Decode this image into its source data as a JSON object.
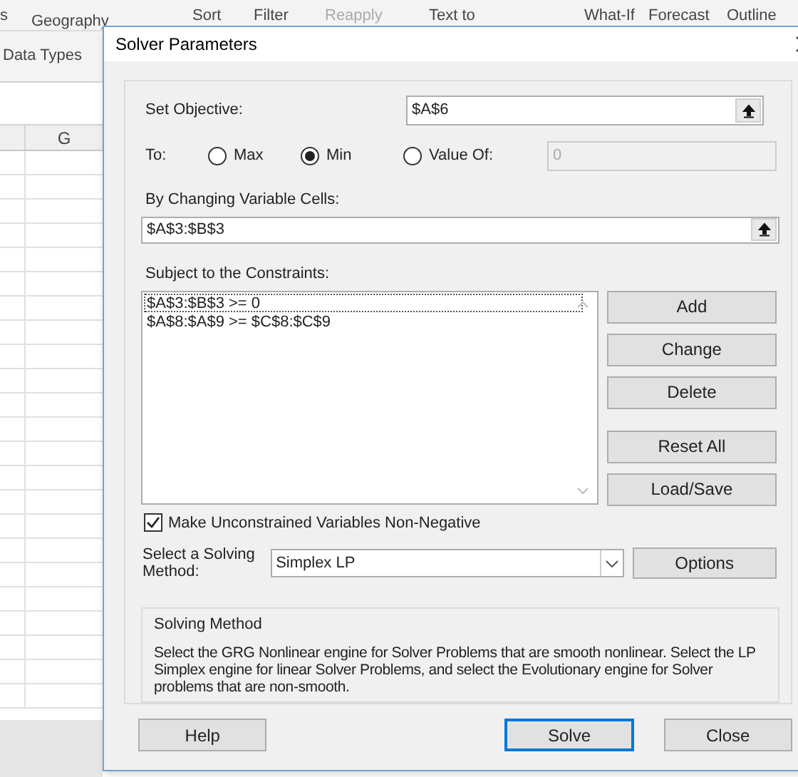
{
  "ribbon": {
    "items": [
      {
        "label": "s",
        "dim": false
      },
      {
        "label": "Geography",
        "dim": false
      },
      {
        "label": "Sort",
        "dim": false
      },
      {
        "label": "Filter",
        "dim": false
      },
      {
        "label": "Reapply",
        "dim": true
      },
      {
        "label": "Text to",
        "dim": false
      },
      {
        "label": "What-If",
        "dim": false
      },
      {
        "label": "Forecast",
        "dim": false
      },
      {
        "label": "Outline",
        "dim": false
      }
    ],
    "group_label": "Data Types"
  },
  "sheet": {
    "column_header": "G"
  },
  "dialog": {
    "title": "Solver Parameters",
    "objective": {
      "label": "Set Objective:",
      "value": "$A$6"
    },
    "to": {
      "label": "To:",
      "options": [
        {
          "label": "Max",
          "selected": false
        },
        {
          "label": "Min",
          "selected": true
        },
        {
          "label": "Value Of:",
          "selected": false
        }
      ],
      "value_field": {
        "value": "0",
        "disabled": true
      }
    },
    "variable_cells": {
      "label": "By Changing Variable Cells:",
      "value": "$A$3:$B$3"
    },
    "constraints": {
      "label": "Subject to the Constraints:",
      "items": [
        {
          "text": "$A$3:$B$3 >= 0",
          "focused": true
        },
        {
          "text": "$A$8:$A$9 >= $C$8:$C$9",
          "focused": false
        }
      ]
    },
    "constraint_buttons": [
      {
        "label": "Add"
      },
      {
        "label": "Change"
      },
      {
        "label": "Delete"
      },
      {
        "label": "Reset All"
      },
      {
        "label": "Load/Save"
      }
    ],
    "nonnegative": {
      "label": "Make Unconstrained Variables Non-Negative",
      "checked": true
    },
    "method": {
      "label": "Select a Solving Method:",
      "value": "Simplex LP",
      "options_button": "Options"
    },
    "method_info": {
      "title": "Solving Method",
      "text": "Select the GRG Nonlinear engine for Solver Problems that are smooth nonlinear. Select the LP Simplex engine for linear Solver Problems, and select the Evolutionary engine for Solver problems that are non-smooth."
    },
    "footer_buttons": [
      {
        "label": "Help",
        "default": false
      },
      {
        "label": "Solve",
        "default": true
      },
      {
        "label": "Close",
        "default": false
      }
    ]
  }
}
